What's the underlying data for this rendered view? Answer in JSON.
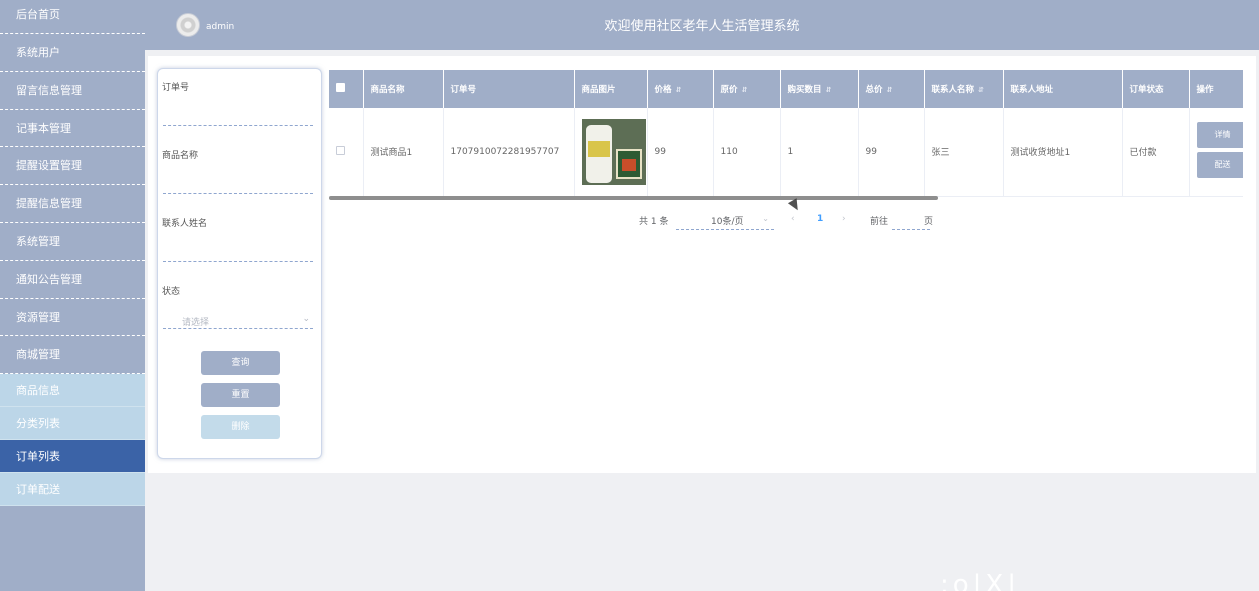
{
  "header": {
    "username": "admin",
    "title": "欢迎使用社区老年人生活管理系统"
  },
  "sidebar": {
    "items": [
      "后台首页",
      "系统用户",
      "留言信息管理",
      "记事本管理",
      "提醒设置管理",
      "提醒信息管理",
      "系统管理",
      "通知公告管理",
      "资源管理",
      "商城管理"
    ],
    "subitems": [
      "商品信息",
      "分类列表",
      "订单列表",
      "订单配送"
    ],
    "active": "订单列表"
  },
  "search": {
    "fields": [
      {
        "label": "订单号"
      },
      {
        "label": "商品名称"
      },
      {
        "label": "联系人姓名"
      },
      {
        "label": "状态",
        "placeholder": "请选择"
      }
    ],
    "buttons": [
      "查询",
      "重置",
      "删除"
    ]
  },
  "table": {
    "columns": [
      "商品名称",
      "订单号",
      "商品图片",
      "价格",
      "原价",
      "购买数目",
      "总价",
      "联系人名称",
      "联系人地址",
      "订单状态",
      "操作"
    ],
    "rows": [
      {
        "product_name": "测试商品1",
        "order_no": "1707910072281957707",
        "price": "99",
        "original_price": "110",
        "quantity": "1",
        "total": "99",
        "contact_name": "张三",
        "contact_address": "测试收货地址1",
        "status": "已付款",
        "actions": [
          "详情",
          "配送"
        ]
      }
    ]
  },
  "pagination": {
    "total_text": "共 1 条",
    "page_size": "10条/页",
    "current_page": "1",
    "goto_label": "前往",
    "page_unit": "页"
  },
  "colors": {
    "sidebar_bg": "#a0aec8",
    "submenu_bg": "#bcd6e8",
    "active_bg": "#3b63a7",
    "accent": "#409eff"
  }
}
